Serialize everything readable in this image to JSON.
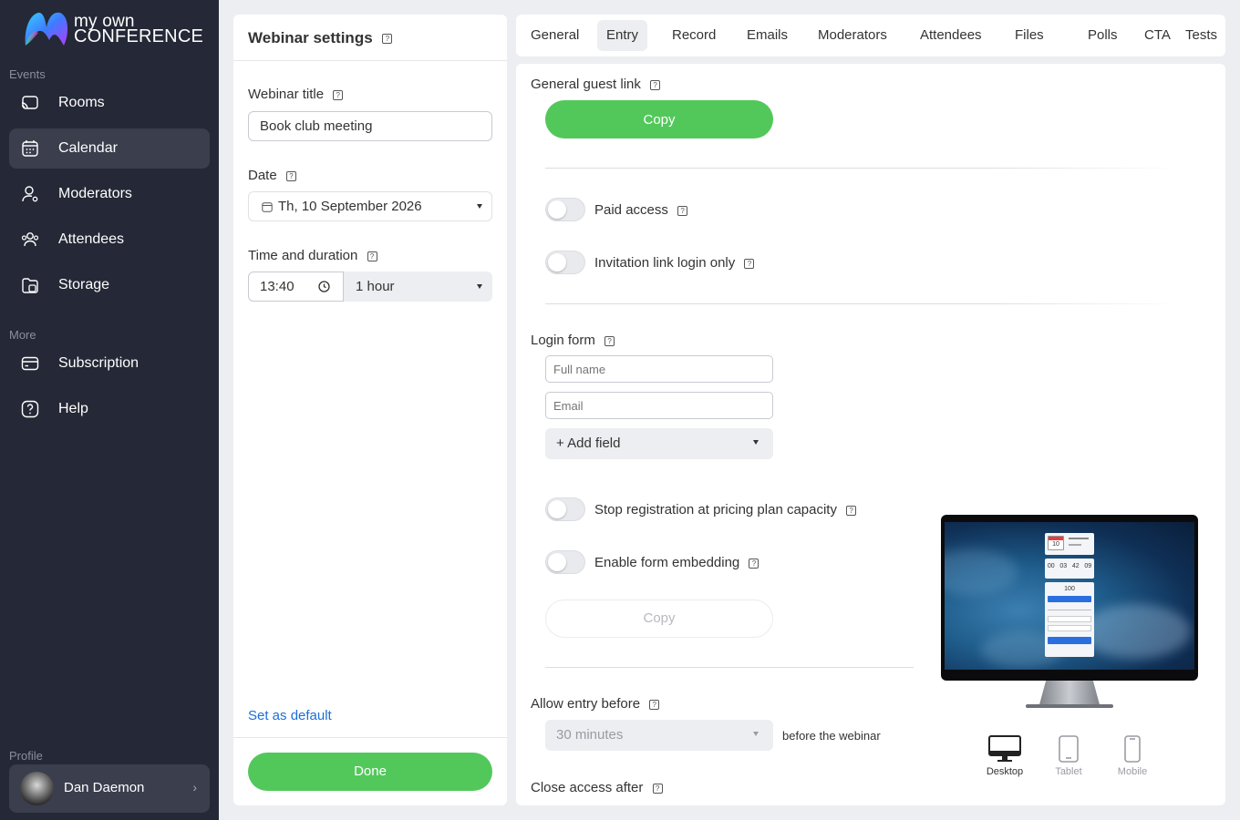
{
  "app": {
    "logo_line1": "my own",
    "logo_line2": "CONFERENCE"
  },
  "sidebar": {
    "section_events": "Events",
    "section_more": "More",
    "section_profile": "Profile",
    "items": [
      {
        "label": "Rooms",
        "icon": "cast-icon"
      },
      {
        "label": "Calendar",
        "icon": "calendar-icon",
        "active": true
      },
      {
        "label": "Moderators",
        "icon": "user-gear-icon"
      },
      {
        "label": "Attendees",
        "icon": "users-icon"
      },
      {
        "label": "Storage",
        "icon": "folder-icon"
      }
    ],
    "more_items": [
      {
        "label": "Subscription",
        "icon": "card-icon"
      },
      {
        "label": "Help",
        "icon": "help-icon"
      }
    ],
    "profile_name": "Dan Daemon"
  },
  "settings": {
    "title": "Webinar settings",
    "webinar_title_label": "Webinar title",
    "webinar_title_value": "Book club meeting",
    "date_label": "Date",
    "date_value": "Th, 10 September 2026",
    "time_label": "Time and duration",
    "time_value": "13:40",
    "duration_value": "1 hour",
    "set_default": "Set as default",
    "done": "Done"
  },
  "tabs": [
    "General",
    "Entry",
    "Record",
    "Emails",
    "Moderators",
    "Attendees",
    "Files",
    "Polls",
    "CTA",
    "Tests"
  ],
  "active_tab": "Entry",
  "entry": {
    "guest_link_label": "General guest link",
    "copy_label": "Copy",
    "paid_access": "Paid access",
    "invitation_only": "Invitation link login only",
    "login_form_label": "Login form",
    "full_name_placeholder": "Full name",
    "email_placeholder": "Email",
    "add_field": "+ Add field",
    "stop_registration": "Stop registration at pricing plan capacity",
    "enable_embedding": "Enable form embedding",
    "embed_copy": "Copy",
    "allow_entry_label": "Allow entry before",
    "allow_entry_value": "30 minutes",
    "before_webinar": "before the webinar",
    "close_access_label": "Close access after"
  },
  "preview": {
    "countdown": [
      "00",
      "03",
      "42",
      "09"
    ],
    "seats": "100",
    "date_num": "10",
    "devices": [
      "Desktop",
      "Tablet",
      "Mobile"
    ],
    "active_device": "Desktop"
  }
}
